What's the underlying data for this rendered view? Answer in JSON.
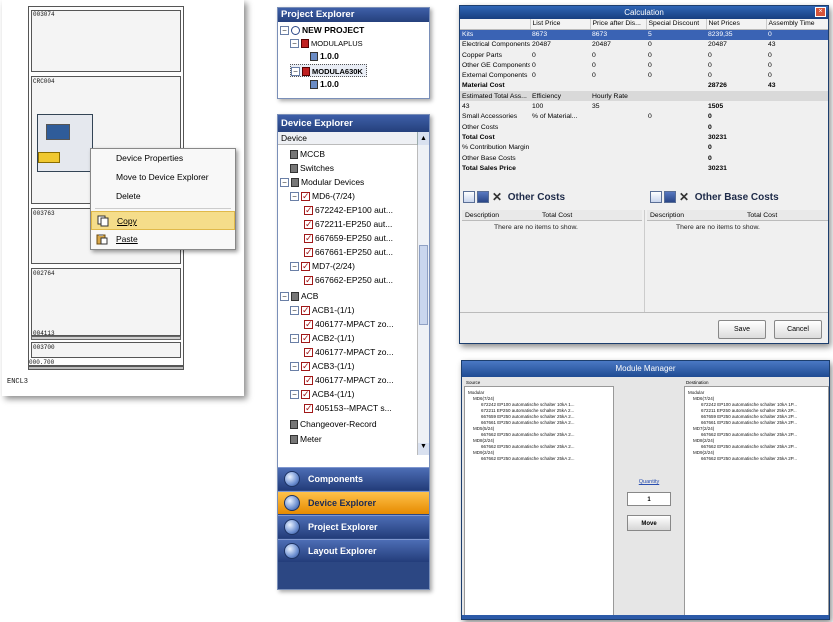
{
  "cabinet": {
    "labels": [
      "003074",
      "CRC004",
      "003763",
      "002764",
      "004113",
      "003700",
      "000.700"
    ],
    "caption": "ENCL3"
  },
  "context_menu": {
    "items": [
      {
        "label": "Device Properties",
        "icon": "none"
      },
      {
        "label": "Move to Device Explorer",
        "icon": "none"
      },
      {
        "label": "Delete",
        "icon": "none"
      },
      {
        "label": "Copy",
        "icon": "copy-icon",
        "selected": true
      },
      {
        "label": "Paste",
        "icon": "paste-icon"
      }
    ]
  },
  "project_explorer": {
    "title": "Project Explorer",
    "nodes": [
      {
        "label": "NEW PROJECT",
        "depth": 0,
        "bold": true
      },
      {
        "label": "MODULAPLUS",
        "depth": 1
      },
      {
        "label": "1.0.0",
        "depth": 2,
        "bold": true
      },
      {
        "label": "MODULA630K",
        "depth": 1,
        "bold": true
      },
      {
        "label": "1.0.0",
        "depth": 2,
        "bold": true
      }
    ]
  },
  "device_explorer": {
    "title": "Device Explorer",
    "column": "Device",
    "nodes": [
      {
        "label": "MCCB",
        "depth": 0,
        "kind": "dev"
      },
      {
        "label": "Switches",
        "depth": 0,
        "kind": "dev"
      },
      {
        "label": "Modular Devices",
        "depth": 0,
        "kind": "dev",
        "expanded": true
      },
      {
        "label": "MD6-(7/24)",
        "depth": 1,
        "kind": "chk",
        "expanded": true
      },
      {
        "label": "672242-EP100 aut...",
        "depth": 2,
        "kind": "chk"
      },
      {
        "label": "672211-EP250 aut...",
        "depth": 2,
        "kind": "chk"
      },
      {
        "label": "667659-EP250 aut...",
        "depth": 2,
        "kind": "chk"
      },
      {
        "label": "667661-EP250 aut...",
        "depth": 2,
        "kind": "chk"
      },
      {
        "label": "MD7-(2/24)",
        "depth": 1,
        "kind": "chk",
        "expanded": true
      },
      {
        "label": "667662-EP250 aut...",
        "depth": 2,
        "kind": "chk"
      },
      {
        "label": "ACB",
        "depth": 0,
        "kind": "dev",
        "expanded": true
      },
      {
        "label": "ACB1-(1/1)",
        "depth": 1,
        "kind": "chk",
        "expanded": true
      },
      {
        "label": "406177-MPACT zo...",
        "depth": 2,
        "kind": "chk"
      },
      {
        "label": "ACB2-(1/1)",
        "depth": 1,
        "kind": "chk",
        "expanded": true
      },
      {
        "label": "406177-MPACT zo...",
        "depth": 2,
        "kind": "chk"
      },
      {
        "label": "ACB3-(1/1)",
        "depth": 1,
        "kind": "chk",
        "expanded": true
      },
      {
        "label": "406177-MPACT zo...",
        "depth": 2,
        "kind": "chk"
      },
      {
        "label": "ACB4-(1/1)",
        "depth": 1,
        "kind": "chk",
        "expanded": true
      },
      {
        "label": "405153--MPACT s...",
        "depth": 2,
        "kind": "chk"
      },
      {
        "label": "Changeover-Record",
        "depth": 0,
        "kind": "dev"
      },
      {
        "label": "Meter",
        "depth": 0,
        "kind": "dev"
      }
    ],
    "nav": [
      {
        "label": "Components",
        "active": false
      },
      {
        "label": "Device Explorer",
        "active": true
      },
      {
        "label": "Project Explorer",
        "active": false
      },
      {
        "label": "Layout Explorer",
        "active": false
      }
    ]
  },
  "calculation": {
    "title": "Calculation",
    "headers": [
      "",
      "List Price",
      "Price after Dis...",
      "Special Discount",
      "Net Prices",
      "Assembly Time"
    ],
    "rows": [
      {
        "cells": [
          "Kits",
          "8673",
          "8673",
          "5",
          "8239,35",
          "0"
        ],
        "style": "sel"
      },
      {
        "cells": [
          "Electrical Components",
          "20487",
          "20487",
          "0",
          "20487",
          "43"
        ],
        "style": ""
      },
      {
        "cells": [
          "Copper Parts",
          "0",
          "0",
          "0",
          "0",
          "0"
        ],
        "style": ""
      },
      {
        "cells": [
          "Other GE Components",
          "0",
          "0",
          "0",
          "0",
          "0"
        ],
        "style": ""
      },
      {
        "cells": [
          "External Components",
          "0",
          "0",
          "0",
          "0",
          "0"
        ],
        "style": ""
      },
      {
        "cells": [
          "Material Cost",
          "",
          "",
          "",
          "28726",
          "43"
        ],
        "style": "bold"
      },
      {
        "cells": [
          "Estimated Total Ass...",
          "Efficiency",
          "Hourly Rate",
          "",
          "",
          ""
        ],
        "style": "grey"
      },
      {
        "cells": [
          "43",
          "100",
          "35",
          "",
          "1505",
          ""
        ],
        "style": "netbold"
      },
      {
        "cells": [
          "Small Accessories",
          "% of Material...",
          "",
          "0",
          "0",
          ""
        ],
        "style": "netbold"
      },
      {
        "cells": [
          "Other Costs",
          "",
          "",
          "",
          "0",
          ""
        ],
        "style": "netbold"
      },
      {
        "cells": [
          "Total Cost",
          "",
          "",
          "",
          "30231",
          ""
        ],
        "style": "bold"
      },
      {
        "cells": [
          "% Contribution Margin",
          "",
          "",
          "",
          "0",
          ""
        ],
        "style": "netbold"
      },
      {
        "cells": [
          "Other Base Costs",
          "",
          "",
          "",
          "0",
          ""
        ],
        "style": "netbold"
      },
      {
        "cells": [
          "Total Sales Price",
          "",
          "",
          "",
          "30231",
          ""
        ],
        "style": "bold"
      }
    ],
    "other_costs": {
      "title": "Other Costs",
      "columns": [
        "Description",
        "Total Cost"
      ],
      "empty": "There are no items to show."
    },
    "other_base_costs": {
      "title": "Other Base Costs",
      "columns": [
        "Description",
        "Total Cost"
      ],
      "empty": "There are no items to show."
    },
    "save_label": "Save",
    "cancel_label": "Cancel"
  },
  "module_manager": {
    "title": "Module Manager",
    "source_label": "Source",
    "destination_label": "Destination",
    "quantity_label": "Quantity",
    "quantity_value": "1",
    "move_label": "Move",
    "source_lines": [
      "Modular",
      "MD6(7/24)",
      "672242 EP100 automatische schalter 10kA 1...",
      "672211 EP250 automatische schalter 25kA 2...",
      "667659 EP250 automatische schalter 25kA 2...",
      "667661 EP250 automatische schalter 25kA 2...",
      "MD5(5/24)",
      "667662 EP250 automatische schalter 25kA 2...",
      "MD8(2/24)",
      "667662 EP250 automatische schalter 25kA 2...",
      "MD9(2/24)",
      "667662 EP250 automatische schalter 25kA 2..."
    ],
    "destination_lines": [
      "Modular",
      "MD6(7/24)",
      "672242 EP100 automatische schalter 10kA 1P...",
      "672211 EP250 automatische schalter 25kA 2P...",
      "667659 EP250 automatische schalter 25kA 2P...",
      "667661 EP250 automatische schalter 25kA 2P...",
      "MD7(2/24)",
      "667662 EP250 automatische schalter 25kA 2P...",
      "MD8(2/24)",
      "667662 EP250 automatische schalter 25kA 2P...",
      "MD9(2/24)",
      "667662 EP250 automatische schalter 25kA 2P..."
    ]
  }
}
